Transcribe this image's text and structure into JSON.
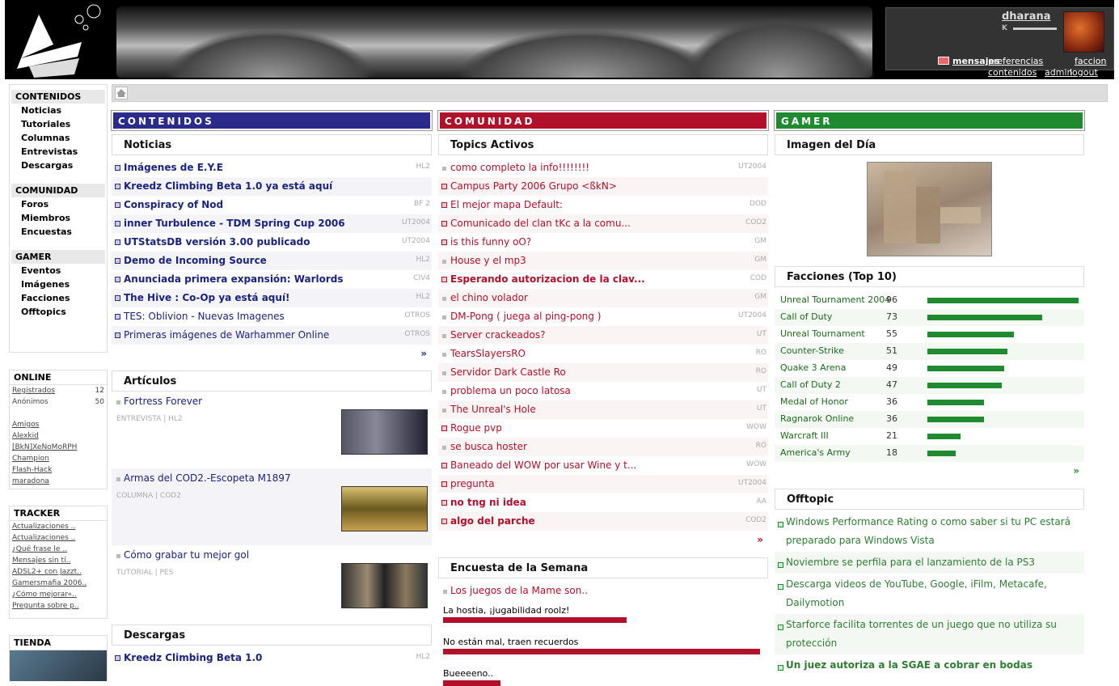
{
  "user": {
    "name": "dharana",
    "rank": "K",
    "links": {
      "mensajes": "mensajes",
      "preferencias": "preferencias",
      "faccion": "faccion",
      "contenidos": "contenidos",
      "admin": "admin",
      "logout": "logout"
    }
  },
  "nav": {
    "contenidos": {
      "title": "CONTENIDOS",
      "items": [
        "Noticias",
        "Tutoriales",
        "Columnas",
        "Entrevistas",
        "Descargas"
      ]
    },
    "comunidad": {
      "title": "COMUNIDAD",
      "items": [
        "Foros",
        "Miembros",
        "Encuestas"
      ]
    },
    "gamer": {
      "title": "GAMER",
      "items": [
        "Eventos",
        "Imágenes",
        "Facciones",
        "Offtopics"
      ]
    }
  },
  "online": {
    "title": "ONLINE",
    "registrados_label": "Registrados",
    "registrados": "12",
    "anonimos_label": "Anónimos",
    "anonimos": "50",
    "amigos": "Amigos",
    "users": [
      "Alexkid",
      "[BkN]XeNoMoRPH",
      "Champion",
      "Flash-Hack",
      "maradona"
    ]
  },
  "tracker": {
    "title": "TRACKER",
    "items": [
      "Actualizaciones ..",
      "Actualizaciones ..",
      "¿Qué frase le ..",
      "Mensajes sin tí..",
      "ADSL2+ con Jazzt..",
      "Gamersmafia 2006..",
      "¿Cómo mejorar«..",
      "Pregunta sobre p.."
    ]
  },
  "tienda": {
    "title": "TIENDA"
  },
  "columns": {
    "contenidos": "CONTENIDOS",
    "comunidad": "COMUNIDAD",
    "gamer": "GAMER"
  },
  "colors": {
    "contenidos": "#2b2b8c",
    "comunidad": "#b0102a",
    "gamer": "#1f8a30"
  },
  "noticias": {
    "title": "Noticias",
    "more": "»",
    "items": [
      {
        "t": "Imágenes de E.Y.E",
        "tag": "HL2",
        "b": true
      },
      {
        "t": "Kreedz Climbing Beta 1.0 ya está aquí",
        "tag": "",
        "b": true
      },
      {
        "t": "Conspiracy of Nod",
        "tag": "BF 2",
        "b": true
      },
      {
        "t": "inner Turbulence - TDM Spring Cup 2006",
        "tag": "UT2004",
        "b": true
      },
      {
        "t": "UTStatsDB versión 3.00 publicado",
        "tag": "UT2004",
        "b": true
      },
      {
        "t": "Demo de Incoming Source",
        "tag": "HL2",
        "b": true
      },
      {
        "t": "Anunciada primera expansión: Warlords",
        "tag": "CIV4",
        "b": true
      },
      {
        "t": "The Hive : Co-Op ya está aquí!",
        "tag": "HL2",
        "b": true
      },
      {
        "t": "TES: Oblivion - Nuevas Imagenes",
        "tag": "OTROS",
        "b": false
      },
      {
        "t": "Primeras imágenes de Warhammer Online",
        "tag": "OTROS",
        "b": false
      }
    ]
  },
  "articulos": {
    "title": "Artículos",
    "items": [
      {
        "t": "Fortress Forever",
        "meta": "ENTREVISTA | HL2"
      },
      {
        "t": "Armas del COD2.-Escopeta M1897",
        "meta": "COLUMNA | COD2"
      },
      {
        "t": "Cómo grabar tu mejor gol",
        "meta": "TUTORIAL | PES"
      }
    ]
  },
  "descargas": {
    "title": "Descargas",
    "items": [
      {
        "t": "Kreedz Climbing Beta 1.0",
        "tag": "HL2"
      }
    ]
  },
  "topics": {
    "title": "Topics Activos",
    "more": "»",
    "items": [
      {
        "t": "como completo la info!!!!!!!!",
        "tag": "UT2004",
        "b": false,
        "read": true
      },
      {
        "t": "Campus Party 2006 Grupo <ßkN>",
        "tag": "",
        "b": false,
        "read": false
      },
      {
        "t": "El mejor mapa Default:",
        "tag": "DOD",
        "b": false,
        "read": false
      },
      {
        "t": "Comunicado del clan tKc a la comu...",
        "tag": "COD2",
        "b": false,
        "read": false
      },
      {
        "t": "is this funny oO?",
        "tag": "GM",
        "b": false,
        "read": false
      },
      {
        "t": "House y el mp3",
        "tag": "GM",
        "b": false,
        "read": true
      },
      {
        "t": "Esperando autorizacion de la clav...",
        "tag": "COD",
        "b": true,
        "read": false
      },
      {
        "t": "el chino volador",
        "tag": "GM",
        "b": false,
        "read": true
      },
      {
        "t": "DM-Pong ( juega al ping-pong )",
        "tag": "UT2004",
        "b": false,
        "read": true
      },
      {
        "t": "Server crackeados?",
        "tag": "UT",
        "b": false,
        "read": true
      },
      {
        "t": "TearsSlayersRO",
        "tag": "RO",
        "b": false,
        "read": true
      },
      {
        "t": "Servidor Dark Castle Ro",
        "tag": "RO",
        "b": false,
        "read": true
      },
      {
        "t": "problema un poco latosa",
        "tag": "UT",
        "b": false,
        "read": true
      },
      {
        "t": "The Unreal's Hole",
        "tag": "UT",
        "b": false,
        "read": true
      },
      {
        "t": "Rogue pvp",
        "tag": "WOW",
        "b": false,
        "read": false
      },
      {
        "t": "se busca hoster",
        "tag": "RO",
        "b": false,
        "read": true
      },
      {
        "t": "Baneado del WOW por usar Wine y t...",
        "tag": "WOW",
        "b": false,
        "read": false
      },
      {
        "t": "pregunta",
        "tag": "UT2004",
        "b": false,
        "read": false
      },
      {
        "t": "no tng ni idea",
        "tag": "AA",
        "b": true,
        "read": false
      },
      {
        "t": "algo del parche",
        "tag": "COD2",
        "b": true,
        "read": false
      }
    ]
  },
  "encuesta": {
    "title": "Encuesta de la Semana",
    "question": "Los juegos de la Mame son..",
    "options": [
      {
        "t": "La hostia, ¡jugabilidad roolz!",
        "pct": 58
      },
      {
        "t": "No están mal, traen recuerdos",
        "pct": 100
      },
      {
        "t": "Bueeeeno..",
        "pct": 18
      }
    ]
  },
  "imagen": {
    "title": "Imagen del Día"
  },
  "facciones": {
    "title": "Facciones (Top 10)",
    "more": "»",
    "items": [
      {
        "n": "Unreal Tournament 2004",
        "v": 96
      },
      {
        "n": "Call of Duty",
        "v": 73
      },
      {
        "n": "Unreal Tournament",
        "v": 55
      },
      {
        "n": "Counter-Strike",
        "v": 51
      },
      {
        "n": "Quake 3 Arena",
        "v": 49
      },
      {
        "n": "Call of Duty 2",
        "v": 47
      },
      {
        "n": "Medal of Honor",
        "v": 36
      },
      {
        "n": "Ragnarok Online",
        "v": 36
      },
      {
        "n": "Warcraft III",
        "v": 21
      },
      {
        "n": "America's Army",
        "v": 18
      }
    ]
  },
  "offtopic": {
    "title": "Offtopic",
    "items": [
      {
        "t": "Windows Performance Rating o como saber si tu PC estará preparado para Windows Vista",
        "b": false
      },
      {
        "t": "Noviembre se perfila para el lanzamiento de la PS3",
        "b": false
      },
      {
        "t": "Descarga videos de YouTube, Google, iFilm, Metacafe, Dailymotion",
        "b": false
      },
      {
        "t": "Starforce facilita torrentes de un juego que no utiliza su protección",
        "b": false
      },
      {
        "t": "Un juez autoriza a la SGAE a cobrar en bodas",
        "b": true
      }
    ]
  }
}
